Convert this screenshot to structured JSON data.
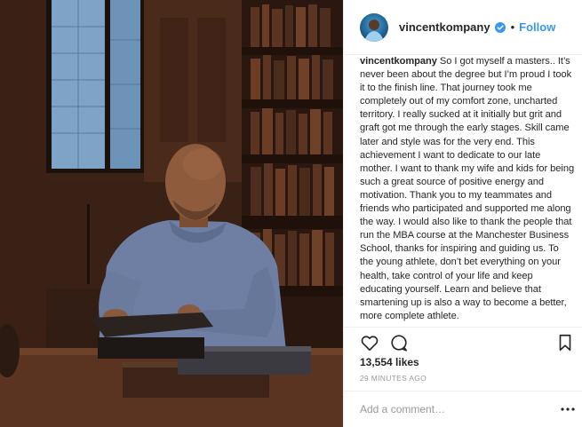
{
  "post": {
    "photo": {
      "subject": "photo-library-seated-man",
      "icon": "post-photo"
    },
    "header": {
      "username": "vincentkompany",
      "separator": "•",
      "follow_label": "Follow",
      "verified_icon": "verified-badge-icon",
      "accent": "#3897f0"
    },
    "caption": {
      "username": "vincentkompany",
      "text": "So I got myself a masters.. It’s never been about the degree but I’m proud I took it to the finish line. That journey took me completely out of my comfort zone, uncharted territory. I really sucked at it initially but grit and graft got me through the early stages. Skill came later and style was for the very end. This achievement I want to dedicate to our late mother. I want to thank my wife and kids for being such a great source of positive energy and motivation. Thank you to my teammates and friends who participated and supported me along the way. I would also like to thank the people that run the MBA course at the Manchester Business School, thanks for inspiring and guiding us. To the young athlete, don’t bet everything on your health, take control of your life and keep educating yourself. Learn and believe that smartening up is also a way to become a better, more complete athlete."
    },
    "actions": {
      "icons": [
        "heart-icon",
        "comment-icon",
        "bookmark-icon"
      ]
    },
    "likes": "13,554 likes",
    "timestamp": "29 MINUTES AGO",
    "comment": {
      "placeholder": "Add a comment…",
      "more_icon": "more-options-icon"
    }
  }
}
